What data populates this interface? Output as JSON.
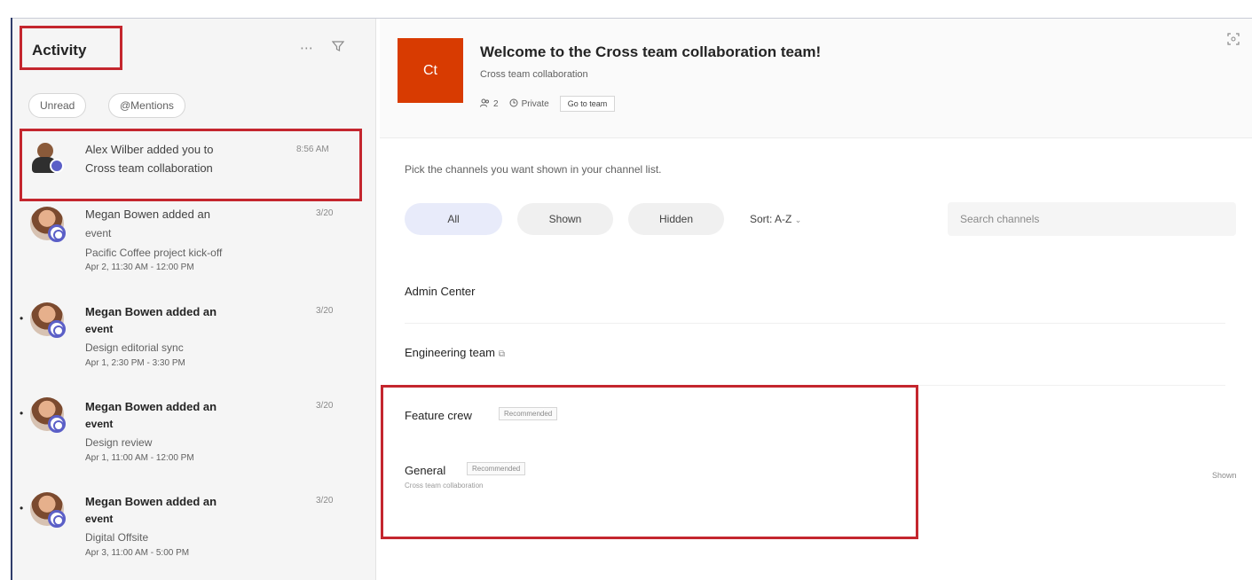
{
  "activity": {
    "title": "Activity",
    "more_icon": "more-icon",
    "filter_icon": "filter-icon",
    "chips": [
      "Unread",
      "@Mentions"
    ],
    "items": [
      {
        "title": "Alex Wilber added you to",
        "subtitle": "Cross team collaboration",
        "time": "8:56 AM",
        "bold": false,
        "unread": false
      },
      {
        "title": "Megan Bowen added an",
        "title2": "event",
        "subtitle": "Pacific Coffee project kick-off",
        "detail": "Apr 2, 11:30 AM - 12:00 PM",
        "time": "3/20",
        "bold": false,
        "unread": false
      },
      {
        "title": "Megan Bowen added an",
        "title2": "event",
        "subtitle": "Design editorial sync",
        "detail": "Apr 1, 2:30 PM - 3:30 PM",
        "time": "3/20",
        "bold": true,
        "unread": true
      },
      {
        "title": "Megan Bowen added an",
        "title2": "event",
        "subtitle": "Design review",
        "detail": "Apr 1, 11:00 AM - 12:00 PM",
        "time": "3/20",
        "bold": true,
        "unread": true
      },
      {
        "title": "Megan Bowen added an",
        "title2": "event",
        "subtitle": "Digital Offsite",
        "detail": "Apr 3, 11:00 AM - 5:00 PM",
        "time": "3/20",
        "bold": true,
        "unread": true
      }
    ]
  },
  "team": {
    "initials": "Ct",
    "title": "Welcome to the Cross team collaboration team!",
    "subtitle": "Cross team collaboration",
    "member_count": "2",
    "privacy": "Private",
    "goto_label": "Go to team"
  },
  "channels": {
    "instruction": "Pick the channels you want shown in your channel list.",
    "filters": [
      "All",
      "Shown",
      "Hidden"
    ],
    "sort_label": "Sort: A-Z",
    "search_placeholder": "Search channels",
    "list": [
      {
        "name": "Admin Center"
      },
      {
        "name": "Engineering team"
      },
      {
        "name": "Feature crew",
        "badge": "Recommended"
      },
      {
        "name": "General",
        "badge": "Recommended",
        "description": "Cross team collaboration",
        "status": "Shown"
      }
    ]
  },
  "colors": {
    "highlight": "#c4262e",
    "team_tile": "#d83b01",
    "accent": "#5b5fc7"
  }
}
